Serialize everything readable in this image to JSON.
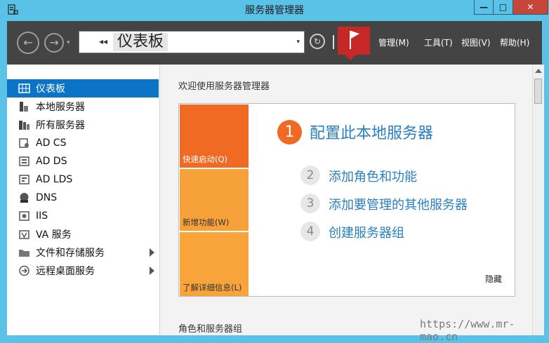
{
  "window": {
    "title": "服务器管理器",
    "minimize": "—",
    "maximize": "□",
    "close": "✕"
  },
  "toolbar": {
    "back_icon": "←",
    "forward_icon": "→",
    "dropdown_icon": "▾",
    "breadcrumb_arrows": "◂◂",
    "breadcrumb": "仪表板",
    "breadcrumb_dropdown": "▾",
    "refresh_icon": "↻",
    "menus": [
      "管理(M)",
      "工具(T)",
      "视图(V)",
      "帮助(H)"
    ]
  },
  "sidebar": {
    "items": [
      {
        "label": "仪表板",
        "icon": "dashboard-icon",
        "selected": true
      },
      {
        "label": "本地服务器",
        "icon": "server-icon"
      },
      {
        "label": "所有服务器",
        "icon": "servers-icon"
      },
      {
        "label": "AD CS",
        "icon": "certificate-icon"
      },
      {
        "label": "AD DS",
        "icon": "directory-icon"
      },
      {
        "label": "AD LDS",
        "icon": "directory-icon"
      },
      {
        "label": "DNS",
        "icon": "dns-icon"
      },
      {
        "label": "IIS",
        "icon": "iis-icon"
      },
      {
        "label": "VA 服务",
        "icon": "va-icon"
      },
      {
        "label": "文件和存储服务",
        "icon": "folder-icon",
        "has_submenu": true
      },
      {
        "label": "远程桌面服务",
        "icon": "remote-desktop-icon",
        "has_submenu": true
      }
    ]
  },
  "main": {
    "welcome": "欢迎使用服务器管理器",
    "tiles": [
      "快速启动(Q)",
      "新增功能(W)",
      "了解详细信息(L)"
    ],
    "steps": [
      {
        "num": "1",
        "label": "配置此本地服务器"
      },
      {
        "num": "2",
        "label": "添加角色和功能"
      },
      {
        "num": "3",
        "label": "添加要管理的其他服务器"
      },
      {
        "num": "4",
        "label": "创建服务器组"
      }
    ],
    "hide": "隐藏",
    "section2": "角色和服务器组"
  },
  "watermark": "https://www.mr-mao.cn",
  "colors": {
    "titlebar": "#5bc2e7",
    "toolbar": "#444444",
    "selected": "#0b74c6",
    "orange": "#f06a24",
    "light_orange": "#f7a13a",
    "link": "#2a7fc1",
    "flag": "#c62828"
  }
}
